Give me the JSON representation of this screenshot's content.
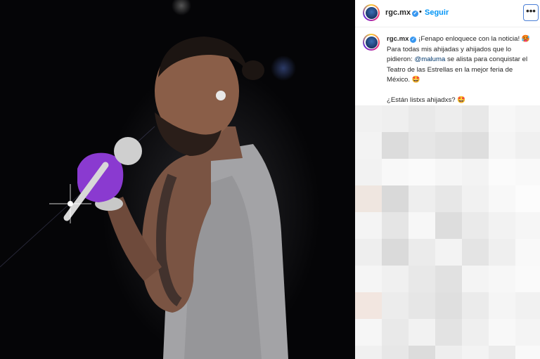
{
  "post": {
    "username": "rgc.mx",
    "follow_label": "Seguir",
    "separator": "•",
    "more_label": "•••",
    "verified_mark": "✓",
    "avatar_icon": "avatar-icon"
  },
  "caption": {
    "username": "rgc.mx",
    "text_1": "¡Fenapo enloquece con la noticia! 🥵 Para todas mis ahijadas y ahijados que lo pidieron: ",
    "mention": "@maluma",
    "text_2": " se alista para conquistar el Teatro de las Estrellas en la mejor feria de México. 🤩",
    "text_3": "¿Están listxs ahijadxs? 🤩"
  },
  "colors": {
    "follow": "#0095f6",
    "verified": "#3897f0",
    "mention": "#00376b",
    "glove": "#8a3ad0"
  },
  "pixel_tones": [
    "#f1f1f1",
    "#efefef",
    "#e9e9e9",
    "#ededed",
    "#e8e8e8",
    "#f7f7f7",
    "#f4f4f4",
    "#f3f3f3",
    "#dcdcdc",
    "#e6e6e6",
    "#e2e2e2",
    "#dedede",
    "#f5f5f5",
    "#f0f0f0",
    "#f2f2f2",
    "#f8f8f8",
    "#fafafa",
    "#f6f6f6",
    "#f3f3f3",
    "#fbfbfb",
    "#f9f9f9",
    "#efe6e0",
    "#d9d9d9",
    "#eeeeee",
    "#e7e7e7",
    "#f1f1f1",
    "#f8f8f8",
    "#fcfcfc",
    "#f4f4f4",
    "#e5e5e5",
    "#f7f7f7",
    "#dddddd",
    "#eaeaea",
    "#f2f2f2",
    "#f6f6f6",
    "#eeeeee",
    "#dadada",
    "#ebebeb",
    "#f3f3f3",
    "#e4e4e4",
    "#efefef",
    "#f9f9f9",
    "#f5f5f5",
    "#f0f0f0",
    "#e8e8e8",
    "#e1e1e1",
    "#f4f4f4",
    "#f7f7f7",
    "#fafafa",
    "#f2e6e0",
    "#ececec",
    "#e6e6e6",
    "#dfdfdf",
    "#ebebeb",
    "#f5f5f5",
    "#f1f1f1",
    "#f6f6f6",
    "#e9e9e9",
    "#f2f2f2",
    "#e3e3e3",
    "#efefef",
    "#f8f8f8",
    "#f4f4f4",
    "#f0f0f0",
    "#e7e7e7",
    "#dcdcdc",
    "#eeeeee",
    "#f3f3f3",
    "#ebebeb",
    "#f9f9f9"
  ]
}
